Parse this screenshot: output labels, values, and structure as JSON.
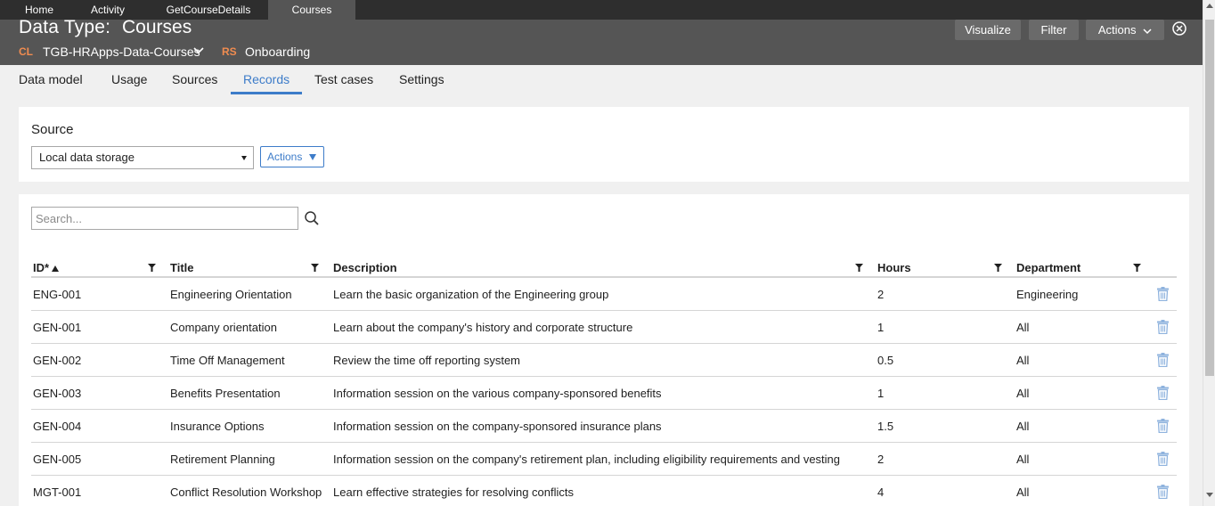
{
  "tabs": [
    {
      "label": "Home"
    },
    {
      "label": "Activity"
    },
    {
      "label": "GetCourseDetails"
    },
    {
      "label": "Courses",
      "active": true
    }
  ],
  "header": {
    "type_label": "Data Type:",
    "type_name": "Courses",
    "class_badge": "CL",
    "class_name": "TGB-HRApps-Data-Courses",
    "ruleset_badge": "RS",
    "ruleset_name": "Onboarding",
    "buttons": {
      "visualize": "Visualize",
      "filter": "Filter",
      "actions": "Actions"
    },
    "badge_color": "#f08c50"
  },
  "subtabs": [
    {
      "label": "Data model"
    },
    {
      "label": "Usage"
    },
    {
      "label": "Sources"
    },
    {
      "label": "Records",
      "active": true
    },
    {
      "label": "Test cases"
    },
    {
      "label": "Settings"
    }
  ],
  "source": {
    "title": "Source",
    "selected": "Local data storage",
    "actions_label": "Actions"
  },
  "search": {
    "placeholder": "Search..."
  },
  "table": {
    "columns": [
      "ID*",
      "Title",
      "Description",
      "Hours",
      "Department"
    ],
    "rows": [
      {
        "id": "ENG-001",
        "title": "Engineering Orientation",
        "description": "Learn the basic organization of the Engineering group",
        "hours": "2",
        "department": "Engineering"
      },
      {
        "id": "GEN-001",
        "title": "Company orientation",
        "description": "Learn about the company's history and corporate structure",
        "hours": "1",
        "department": "All"
      },
      {
        "id": "GEN-002",
        "title": "Time Off Management",
        "description": "Review the time off reporting system",
        "hours": "0.5",
        "department": "All"
      },
      {
        "id": "GEN-003",
        "title": "Benefits Presentation",
        "description": "Information session on the various company-sponsored benefits",
        "hours": "1",
        "department": "All"
      },
      {
        "id": "GEN-004",
        "title": "Insurance Options",
        "description": "Information session on the company-sponsored insurance plans",
        "hours": "1.5",
        "department": "All"
      },
      {
        "id": "GEN-005",
        "title": "Retirement Planning",
        "description": "Information session on the company's retirement plan, including eligibility requirements and vesting",
        "hours": "2",
        "department": "All"
      },
      {
        "id": "MGT-001",
        "title": "Conflict Resolution Workshop",
        "description": "Learn effective strategies for resolving conflicts",
        "hours": "4",
        "department": "All"
      }
    ]
  },
  "colors": {
    "accent": "#3d7cc9",
    "header_bg": "#555555",
    "tabbar_bg": "#2e2e2e"
  }
}
